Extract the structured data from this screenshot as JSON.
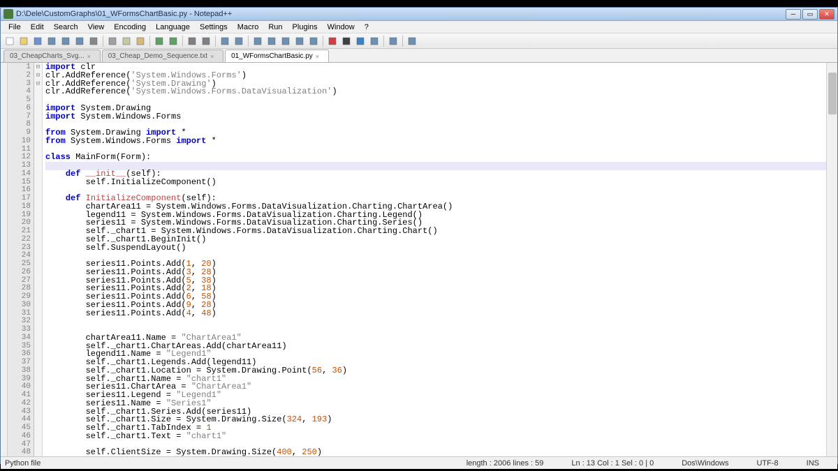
{
  "window": {
    "title": "D:\\Dele\\CustomGraphs\\01_WFormsChartBasic.py - Notepad++"
  },
  "menus": [
    "File",
    "Edit",
    "Search",
    "View",
    "Encoding",
    "Language",
    "Settings",
    "Macro",
    "Run",
    "Plugins",
    "Window",
    "?"
  ],
  "tabs": [
    {
      "label": "03_CheapCharts_Svg...",
      "active": false
    },
    {
      "label": "03_Cheap_Demo_Sequence.txt",
      "active": false
    },
    {
      "label": "01_WFormsChartBasic.py",
      "active": true
    }
  ],
  "code": {
    "lines": [
      {
        "n": 1,
        "segs": [
          {
            "t": "import ",
            "c": "kw"
          },
          {
            "t": "clr"
          }
        ]
      },
      {
        "n": 2,
        "segs": [
          {
            "t": "clr.AddReference("
          },
          {
            "t": "'System.Windows.Forms'",
            "c": "str"
          },
          {
            "t": ")"
          }
        ]
      },
      {
        "n": 3,
        "segs": [
          {
            "t": "clr.AddReference("
          },
          {
            "t": "'System.Drawing'",
            "c": "str"
          },
          {
            "t": ")"
          }
        ]
      },
      {
        "n": 4,
        "segs": [
          {
            "t": "clr.AddReference("
          },
          {
            "t": "'System.Windows.Forms.DataVisualization'",
            "c": "str"
          },
          {
            "t": ")"
          }
        ]
      },
      {
        "n": 5,
        "segs": [
          {
            "t": ""
          }
        ]
      },
      {
        "n": 6,
        "segs": [
          {
            "t": "import ",
            "c": "kw"
          },
          {
            "t": "System.Drawing"
          }
        ]
      },
      {
        "n": 7,
        "segs": [
          {
            "t": "import ",
            "c": "kw"
          },
          {
            "t": "System.Windows.Forms"
          }
        ]
      },
      {
        "n": 8,
        "segs": [
          {
            "t": ""
          }
        ]
      },
      {
        "n": 9,
        "segs": [
          {
            "t": "from ",
            "c": "kw"
          },
          {
            "t": "System.Drawing "
          },
          {
            "t": "import ",
            "c": "kw"
          },
          {
            "t": "*"
          }
        ]
      },
      {
        "n": 10,
        "segs": [
          {
            "t": "from ",
            "c": "kw"
          },
          {
            "t": "System.Windows.Forms "
          },
          {
            "t": "import ",
            "c": "kw"
          },
          {
            "t": "*"
          }
        ]
      },
      {
        "n": 11,
        "segs": [
          {
            "t": ""
          }
        ]
      },
      {
        "n": 12,
        "fold": "⊟",
        "segs": [
          {
            "t": "class ",
            "c": "kw"
          },
          {
            "t": "MainForm(Form):"
          }
        ]
      },
      {
        "n": 13,
        "current": true,
        "segs": [
          {
            "t": ""
          }
        ]
      },
      {
        "n": 14,
        "fold": "⊟",
        "segs": [
          {
            "t": "    "
          },
          {
            "t": "def ",
            "c": "kw"
          },
          {
            "t": "__init__",
            "c": "def-name"
          },
          {
            "t": "(self):"
          }
        ]
      },
      {
        "n": 15,
        "segs": [
          {
            "t": "        self.InitializeComponent()"
          }
        ]
      },
      {
        "n": 16,
        "segs": [
          {
            "t": ""
          }
        ]
      },
      {
        "n": 17,
        "fold": "⊟",
        "segs": [
          {
            "t": "    "
          },
          {
            "t": "def ",
            "c": "kw"
          },
          {
            "t": "InitializeComponent",
            "c": "def-name"
          },
          {
            "t": "(self):"
          }
        ]
      },
      {
        "n": 18,
        "segs": [
          {
            "t": "        chartArea11 = System.Windows.Forms.DataVisualization.Charting.ChartArea()"
          }
        ]
      },
      {
        "n": 19,
        "segs": [
          {
            "t": "        legend11 = System.Windows.Forms.DataVisualization.Charting.Legend()"
          }
        ]
      },
      {
        "n": 20,
        "segs": [
          {
            "t": "        series11 = System.Windows.Forms.DataVisualization.Charting.Series()"
          }
        ]
      },
      {
        "n": 21,
        "segs": [
          {
            "t": "        self._chart1 = System.Windows.Forms.DataVisualization.Charting.Chart()"
          }
        ]
      },
      {
        "n": 22,
        "segs": [
          {
            "t": "        self._chart1.BeginInit()"
          }
        ]
      },
      {
        "n": 23,
        "segs": [
          {
            "t": "        self.SuspendLayout()"
          }
        ]
      },
      {
        "n": 24,
        "segs": [
          {
            "t": ""
          }
        ]
      },
      {
        "n": 25,
        "segs": [
          {
            "t": "        series11.Points.Add("
          },
          {
            "t": "1",
            "c": "num"
          },
          {
            "t": ", "
          },
          {
            "t": "20",
            "c": "num"
          },
          {
            "t": ")"
          }
        ]
      },
      {
        "n": 26,
        "segs": [
          {
            "t": "        series11.Points.Add("
          },
          {
            "t": "3",
            "c": "num"
          },
          {
            "t": ", "
          },
          {
            "t": "28",
            "c": "num"
          },
          {
            "t": ")"
          }
        ]
      },
      {
        "n": 27,
        "segs": [
          {
            "t": "        series11.Points.Add("
          },
          {
            "t": "5",
            "c": "num"
          },
          {
            "t": ", "
          },
          {
            "t": "38",
            "c": "num"
          },
          {
            "t": ")"
          }
        ]
      },
      {
        "n": 28,
        "segs": [
          {
            "t": "        series11.Points.Add("
          },
          {
            "t": "2",
            "c": "num"
          },
          {
            "t": ", "
          },
          {
            "t": "18",
            "c": "num"
          },
          {
            "t": ")"
          }
        ]
      },
      {
        "n": 29,
        "segs": [
          {
            "t": "        series11.Points.Add("
          },
          {
            "t": "6",
            "c": "num"
          },
          {
            "t": ", "
          },
          {
            "t": "58",
            "c": "num"
          },
          {
            "t": ")"
          }
        ]
      },
      {
        "n": 30,
        "segs": [
          {
            "t": "        series11.Points.Add("
          },
          {
            "t": "9",
            "c": "num"
          },
          {
            "t": ", "
          },
          {
            "t": "28",
            "c": "num"
          },
          {
            "t": ")"
          }
        ]
      },
      {
        "n": 31,
        "segs": [
          {
            "t": "        series11.Points.Add("
          },
          {
            "t": "4",
            "c": "num"
          },
          {
            "t": ", "
          },
          {
            "t": "48",
            "c": "num"
          },
          {
            "t": ")"
          }
        ]
      },
      {
        "n": 32,
        "segs": [
          {
            "t": ""
          }
        ]
      },
      {
        "n": 33,
        "segs": [
          {
            "t": ""
          }
        ]
      },
      {
        "n": 34,
        "segs": [
          {
            "t": "        chartArea11.Name = "
          },
          {
            "t": "\"ChartArea1\"",
            "c": "str"
          }
        ]
      },
      {
        "n": 35,
        "segs": [
          {
            "t": "        self._chart1.ChartAreas.Add(chartArea11)"
          }
        ]
      },
      {
        "n": 36,
        "segs": [
          {
            "t": "        legend11.Name = "
          },
          {
            "t": "\"Legend1\"",
            "c": "str"
          }
        ]
      },
      {
        "n": 37,
        "segs": [
          {
            "t": "        self._chart1.Legends.Add(legend11)"
          }
        ]
      },
      {
        "n": 38,
        "segs": [
          {
            "t": "        self._chart1.Location = System.Drawing.Point("
          },
          {
            "t": "56",
            "c": "num"
          },
          {
            "t": ", "
          },
          {
            "t": "36",
            "c": "num"
          },
          {
            "t": ")"
          }
        ]
      },
      {
        "n": 39,
        "segs": [
          {
            "t": "        self._chart1.Name = "
          },
          {
            "t": "\"chart1\"",
            "c": "str"
          }
        ]
      },
      {
        "n": 40,
        "segs": [
          {
            "t": "        series11.ChartArea = "
          },
          {
            "t": "\"ChartArea1\"",
            "c": "str"
          }
        ]
      },
      {
        "n": 41,
        "segs": [
          {
            "t": "        series11.Legend = "
          },
          {
            "t": "\"Legend1\"",
            "c": "str"
          }
        ]
      },
      {
        "n": 42,
        "segs": [
          {
            "t": "        series11.Name = "
          },
          {
            "t": "\"Series1\"",
            "c": "str"
          }
        ]
      },
      {
        "n": 43,
        "segs": [
          {
            "t": "        self._chart1.Series.Add(series11)"
          }
        ]
      },
      {
        "n": 44,
        "segs": [
          {
            "t": "        self._chart1.Size = System.Drawing.Size("
          },
          {
            "t": "324",
            "c": "num"
          },
          {
            "t": ", "
          },
          {
            "t": "193",
            "c": "num"
          },
          {
            "t": ")"
          }
        ]
      },
      {
        "n": 45,
        "segs": [
          {
            "t": "        self._chart1.TabIndex = "
          },
          {
            "t": "1",
            "c": "num"
          }
        ]
      },
      {
        "n": 46,
        "segs": [
          {
            "t": "        self._chart1.Text = "
          },
          {
            "t": "\"chart1\"",
            "c": "str"
          }
        ]
      },
      {
        "n": 47,
        "segs": [
          {
            "t": ""
          }
        ]
      },
      {
        "n": 48,
        "segs": [
          {
            "t": "        self.ClientSize = System.Drawing.Size("
          },
          {
            "t": "400",
            "c": "num"
          },
          {
            "t": ", "
          },
          {
            "t": "250",
            "c": "num"
          },
          {
            "t": ")"
          }
        ]
      }
    ]
  },
  "status": {
    "filetype": "Python file",
    "length": "length : 2006    lines : 59",
    "pos": "Ln : 13    Col : 1    Sel : 0 | 0",
    "eol": "Dos\\Windows",
    "encoding": "UTF-8",
    "mode": "INS"
  },
  "toolbar_icons": [
    "new",
    "open",
    "save",
    "save-all",
    "close",
    "close-all",
    "print",
    "",
    "cut",
    "copy",
    "paste",
    "",
    "undo",
    "redo",
    "",
    "find",
    "replace",
    "",
    "zoom-in",
    "zoom-out",
    "",
    "wrap",
    "all-chars",
    "indent",
    "fold",
    "unfold",
    "",
    "record",
    "stop",
    "play",
    "play-multi",
    "",
    "bookmark",
    "",
    "plugin"
  ]
}
